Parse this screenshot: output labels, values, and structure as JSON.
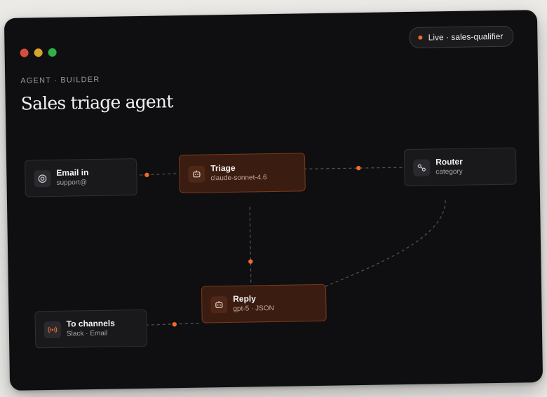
{
  "window": {
    "live_badge": "Live · sales-qualifier",
    "eyebrow": "AGENT · BUILDER",
    "title": "Sales triage agent"
  },
  "nodes": {
    "email_in": {
      "title": "Email in",
      "subtitle": "support@",
      "icon": "target-icon"
    },
    "triage": {
      "title": "Triage",
      "subtitle": "claude-sonnet-4.6",
      "icon": "robot-icon"
    },
    "router": {
      "title": "Router",
      "subtitle": "category",
      "icon": "route-icon"
    },
    "reply": {
      "title": "Reply",
      "subtitle": "gpt-5 · JSON",
      "icon": "robot-icon"
    },
    "to_channels": {
      "title": "To channels",
      "subtitle": "Slack · Email",
      "icon": "broadcast-icon"
    }
  },
  "colors": {
    "accent": "#f06a2a",
    "window_bg": "#0f0f11",
    "node_bg": "#19191c",
    "active_node_bg": "#3a1c11"
  }
}
